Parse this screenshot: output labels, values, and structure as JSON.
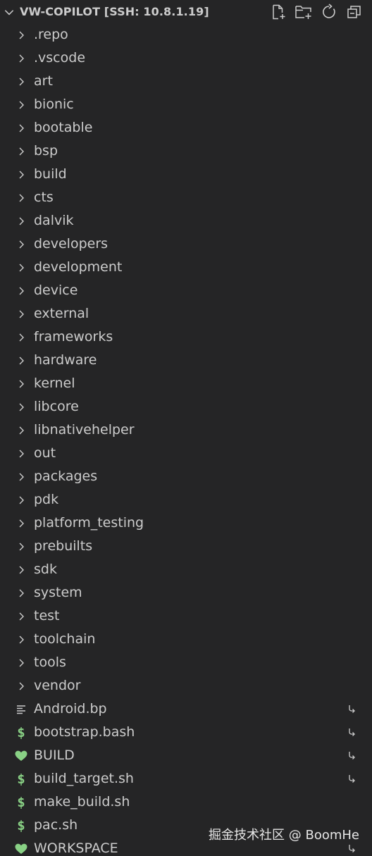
{
  "explorer": {
    "title": "VW-COPILOT [SSH: 10.8.1.19]",
    "actions": [
      {
        "name": "new-file-icon"
      },
      {
        "name": "new-folder-icon"
      },
      {
        "name": "refresh-icon"
      },
      {
        "name": "collapse-all-icon"
      }
    ]
  },
  "folders": [
    ".repo",
    ".vscode",
    "art",
    "bionic",
    "bootable",
    "bsp",
    "build",
    "cts",
    "dalvik",
    "developers",
    "development",
    "device",
    "external",
    "frameworks",
    "hardware",
    "kernel",
    "libcore",
    "libnativehelper",
    "out",
    "packages",
    "pdk",
    "platform_testing",
    "prebuilts",
    "sdk",
    "system",
    "test",
    "toolchain",
    "tools",
    "vendor"
  ],
  "files": [
    {
      "label": "Android.bp",
      "icon": "lines-icon",
      "symlink": true
    },
    {
      "label": "bootstrap.bash",
      "icon": "dollar-icon",
      "symlink": true
    },
    {
      "label": "BUILD",
      "icon": "heart-icon",
      "symlink": true
    },
    {
      "label": "build_target.sh",
      "icon": "dollar-icon",
      "symlink": true
    },
    {
      "label": "make_build.sh",
      "icon": "dollar-icon",
      "symlink": false
    },
    {
      "label": "pac.sh",
      "icon": "dollar-icon",
      "symlink": false
    },
    {
      "label": "WORKSPACE",
      "icon": "heart-icon",
      "symlink": true
    }
  ],
  "colors": {
    "background": "#252526",
    "text": "#cccccc",
    "shell_icon": "#89d185",
    "bazel_icon": "#89d185"
  },
  "watermark": "掘金技术社区 @ BoomHe"
}
